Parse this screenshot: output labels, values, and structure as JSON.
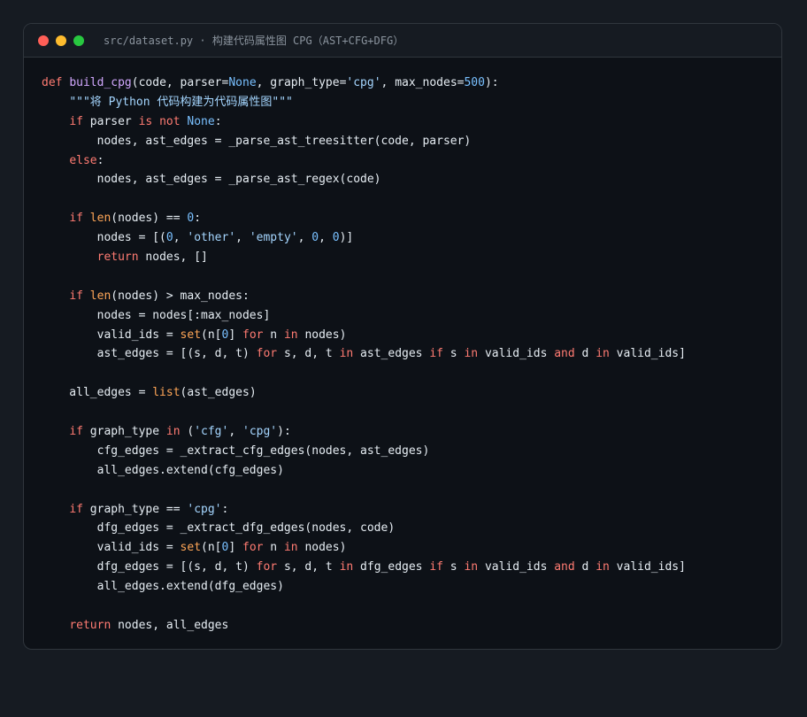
{
  "window": {
    "title": "src/dataset.py · 构建代码属性图 CPG（AST+CFG+DFG）",
    "controls": [
      {
        "name": "close",
        "color": "#ff5f57"
      },
      {
        "name": "minimize",
        "color": "#febc2e"
      },
      {
        "name": "maximize",
        "color": "#28c840"
      }
    ]
  },
  "colors": {
    "background": "#161b22",
    "editor_background": "#0d1117",
    "keyword": "#ff7b72",
    "function": "#d2a8ff",
    "string": "#a5d6ff",
    "number": "#79c0ff",
    "builtin": "#ffa657",
    "plain": "#e6edf3"
  },
  "code": {
    "language": "python",
    "lines": [
      [
        {
          "t": "def",
          "c": "kw"
        },
        {
          "t": " ",
          "c": "pl"
        },
        {
          "t": "build_cpg",
          "c": "fn"
        },
        {
          "t": "(code, parser=",
          "c": "pl"
        },
        {
          "t": "None",
          "c": "cst"
        },
        {
          "t": ", graph_type=",
          "c": "pl"
        },
        {
          "t": "'cpg'",
          "c": "str"
        },
        {
          "t": ", max_nodes=",
          "c": "pl"
        },
        {
          "t": "500",
          "c": "num"
        },
        {
          "t": "):",
          "c": "pl"
        }
      ],
      [
        {
          "t": "    ",
          "c": "pl"
        },
        {
          "t": "\"\"\"将 Python 代码构建为代码属性图\"\"\"",
          "c": "str"
        }
      ],
      [
        {
          "t": "    ",
          "c": "pl"
        },
        {
          "t": "if",
          "c": "kw"
        },
        {
          "t": " parser ",
          "c": "pl"
        },
        {
          "t": "is not",
          "c": "kw"
        },
        {
          "t": " ",
          "c": "pl"
        },
        {
          "t": "None",
          "c": "cst"
        },
        {
          "t": ":",
          "c": "pl"
        }
      ],
      [
        {
          "t": "        nodes, ast_edges = _parse_ast_treesitter(code, parser)",
          "c": "pl"
        }
      ],
      [
        {
          "t": "    ",
          "c": "pl"
        },
        {
          "t": "else",
          "c": "kw"
        },
        {
          "t": ":",
          "c": "pl"
        }
      ],
      [
        {
          "t": "        nodes, ast_edges = _parse_ast_regex(code)",
          "c": "pl"
        }
      ],
      [],
      [
        {
          "t": "    ",
          "c": "pl"
        },
        {
          "t": "if",
          "c": "kw"
        },
        {
          "t": " ",
          "c": "pl"
        },
        {
          "t": "len",
          "c": "bi"
        },
        {
          "t": "(nodes) == ",
          "c": "pl"
        },
        {
          "t": "0",
          "c": "num"
        },
        {
          "t": ":",
          "c": "pl"
        }
      ],
      [
        {
          "t": "        nodes = [(",
          "c": "pl"
        },
        {
          "t": "0",
          "c": "num"
        },
        {
          "t": ", ",
          "c": "pl"
        },
        {
          "t": "'other'",
          "c": "str"
        },
        {
          "t": ", ",
          "c": "pl"
        },
        {
          "t": "'empty'",
          "c": "str"
        },
        {
          "t": ", ",
          "c": "pl"
        },
        {
          "t": "0",
          "c": "num"
        },
        {
          "t": ", ",
          "c": "pl"
        },
        {
          "t": "0",
          "c": "num"
        },
        {
          "t": ")]",
          "c": "pl"
        }
      ],
      [
        {
          "t": "        ",
          "c": "pl"
        },
        {
          "t": "return",
          "c": "kw"
        },
        {
          "t": " nodes, []",
          "c": "pl"
        }
      ],
      [],
      [
        {
          "t": "    ",
          "c": "pl"
        },
        {
          "t": "if",
          "c": "kw"
        },
        {
          "t": " ",
          "c": "pl"
        },
        {
          "t": "len",
          "c": "bi"
        },
        {
          "t": "(nodes) > max_nodes:",
          "c": "pl"
        }
      ],
      [
        {
          "t": "        nodes = nodes[:max_nodes]",
          "c": "pl"
        }
      ],
      [
        {
          "t": "        valid_ids = ",
          "c": "pl"
        },
        {
          "t": "set",
          "c": "bi"
        },
        {
          "t": "(n[",
          "c": "pl"
        },
        {
          "t": "0",
          "c": "num"
        },
        {
          "t": "] ",
          "c": "pl"
        },
        {
          "t": "for",
          "c": "kw"
        },
        {
          "t": " n ",
          "c": "pl"
        },
        {
          "t": "in",
          "c": "kw"
        },
        {
          "t": " nodes)",
          "c": "pl"
        }
      ],
      [
        {
          "t": "        ast_edges = [(s, d, t) ",
          "c": "pl"
        },
        {
          "t": "for",
          "c": "kw"
        },
        {
          "t": " s, d, t ",
          "c": "pl"
        },
        {
          "t": "in",
          "c": "kw"
        },
        {
          "t": " ast_edges ",
          "c": "pl"
        },
        {
          "t": "if",
          "c": "kw"
        },
        {
          "t": " s ",
          "c": "pl"
        },
        {
          "t": "in",
          "c": "kw"
        },
        {
          "t": " valid_ids ",
          "c": "pl"
        },
        {
          "t": "and",
          "c": "kw"
        },
        {
          "t": " d ",
          "c": "pl"
        },
        {
          "t": "in",
          "c": "kw"
        },
        {
          "t": " valid_ids]",
          "c": "pl"
        }
      ],
      [],
      [
        {
          "t": "    all_edges = ",
          "c": "pl"
        },
        {
          "t": "list",
          "c": "bi"
        },
        {
          "t": "(ast_edges)",
          "c": "pl"
        }
      ],
      [],
      [
        {
          "t": "    ",
          "c": "pl"
        },
        {
          "t": "if",
          "c": "kw"
        },
        {
          "t": " graph_type ",
          "c": "pl"
        },
        {
          "t": "in",
          "c": "kw"
        },
        {
          "t": " (",
          "c": "pl"
        },
        {
          "t": "'cfg'",
          "c": "str"
        },
        {
          "t": ", ",
          "c": "pl"
        },
        {
          "t": "'cpg'",
          "c": "str"
        },
        {
          "t": "):",
          "c": "pl"
        }
      ],
      [
        {
          "t": "        cfg_edges = _extract_cfg_edges(nodes, ast_edges)",
          "c": "pl"
        }
      ],
      [
        {
          "t": "        all_edges.extend(cfg_edges)",
          "c": "pl"
        }
      ],
      [],
      [
        {
          "t": "    ",
          "c": "pl"
        },
        {
          "t": "if",
          "c": "kw"
        },
        {
          "t": " graph_type == ",
          "c": "pl"
        },
        {
          "t": "'cpg'",
          "c": "str"
        },
        {
          "t": ":",
          "c": "pl"
        }
      ],
      [
        {
          "t": "        dfg_edges = _extract_dfg_edges(nodes, code)",
          "c": "pl"
        }
      ],
      [
        {
          "t": "        valid_ids = ",
          "c": "pl"
        },
        {
          "t": "set",
          "c": "bi"
        },
        {
          "t": "(n[",
          "c": "pl"
        },
        {
          "t": "0",
          "c": "num"
        },
        {
          "t": "] ",
          "c": "pl"
        },
        {
          "t": "for",
          "c": "kw"
        },
        {
          "t": " n ",
          "c": "pl"
        },
        {
          "t": "in",
          "c": "kw"
        },
        {
          "t": " nodes)",
          "c": "pl"
        }
      ],
      [
        {
          "t": "        dfg_edges = [(s, d, t) ",
          "c": "pl"
        },
        {
          "t": "for",
          "c": "kw"
        },
        {
          "t": " s, d, t ",
          "c": "pl"
        },
        {
          "t": "in",
          "c": "kw"
        },
        {
          "t": " dfg_edges ",
          "c": "pl"
        },
        {
          "t": "if",
          "c": "kw"
        },
        {
          "t": " s ",
          "c": "pl"
        },
        {
          "t": "in",
          "c": "kw"
        },
        {
          "t": " valid_ids ",
          "c": "pl"
        },
        {
          "t": "and",
          "c": "kw"
        },
        {
          "t": " d ",
          "c": "pl"
        },
        {
          "t": "in",
          "c": "kw"
        },
        {
          "t": " valid_ids]",
          "c": "pl"
        }
      ],
      [
        {
          "t": "        all_edges.extend(dfg_edges)",
          "c": "pl"
        }
      ],
      [],
      [
        {
          "t": "    ",
          "c": "pl"
        },
        {
          "t": "return",
          "c": "kw"
        },
        {
          "t": " nodes, all_edges",
          "c": "pl"
        }
      ]
    ]
  }
}
